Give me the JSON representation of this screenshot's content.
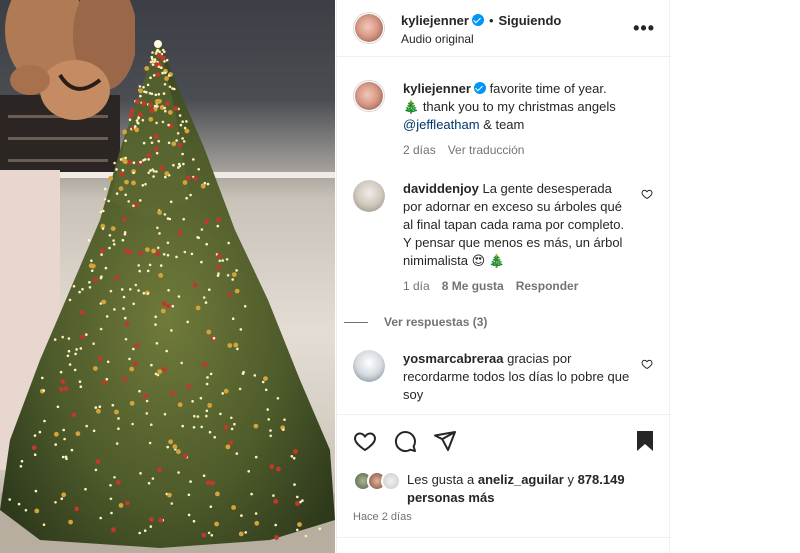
{
  "post": {
    "author": "kyliejenner",
    "following_label": "Siguiendo",
    "separator": "•",
    "audio_label": "Audio original"
  },
  "caption": {
    "author": "kyliejenner",
    "line1": "favorite time of year.",
    "tree_emoji": "🎄",
    "line2": "thank you to my christmas angels",
    "mention": "@jeffleatham",
    "line3_tail": "& team",
    "time": "2 días",
    "translate": "Ver traducción"
  },
  "comments": [
    {
      "user": "daviddenjoy",
      "text": "La gente desesperada por adornar en exceso su árboles qué al final tapan cada rama por completo. Y pensar que menos es más, un árbol nimimalista 😍 🎄",
      "time": "1 día",
      "likes": "8 Me gusta",
      "reply": "Responder",
      "view_replies": "Ver respuestas (3)"
    },
    {
      "user": "yosmarcabreraa",
      "text": "gracias por recordarme todos los días lo pobre que soy"
    }
  ],
  "likes": {
    "prefix": "Les gusta a",
    "user": "aneliz_aguilar",
    "connector": "y",
    "count": "878.149",
    "suffix": "personas más"
  },
  "timestamp": "Hace 2 días",
  "icons": {
    "more": "more-options-icon",
    "verified": "verified-badge-icon",
    "like": "heart-icon",
    "comment": "comment-bubble-icon",
    "share": "paper-plane-icon",
    "save": "bookmark-icon"
  },
  "colors": {
    "verified_blue": "#0095f6",
    "text_primary": "#262626",
    "text_secondary": "#737373",
    "mention": "#00376b"
  }
}
